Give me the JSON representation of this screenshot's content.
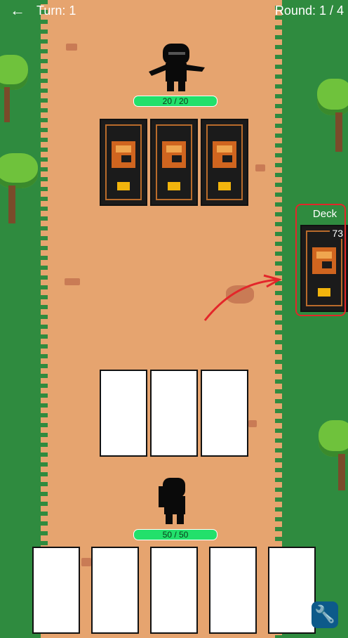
{
  "top_bar": {
    "back_icon": "arrow-left-icon",
    "turn_text": "Turn: 1",
    "round_text": "Round: 1 / 4"
  },
  "enemy": {
    "hp_text": "20 / 20",
    "hp_current": 20,
    "hp_max": 20
  },
  "player": {
    "hp_text": "50 / 50",
    "hp_current": 50,
    "hp_max": 50
  },
  "deck": {
    "label": "Deck",
    "count": "73"
  },
  "tool_button": {
    "icon": "wrench-icon"
  },
  "colors": {
    "grass": "#2f8b3f",
    "path": "#e6a46f",
    "hp_bar": "#1fdc6a",
    "annotation": "#e3262a",
    "tool_button": "#0d5a8a"
  }
}
